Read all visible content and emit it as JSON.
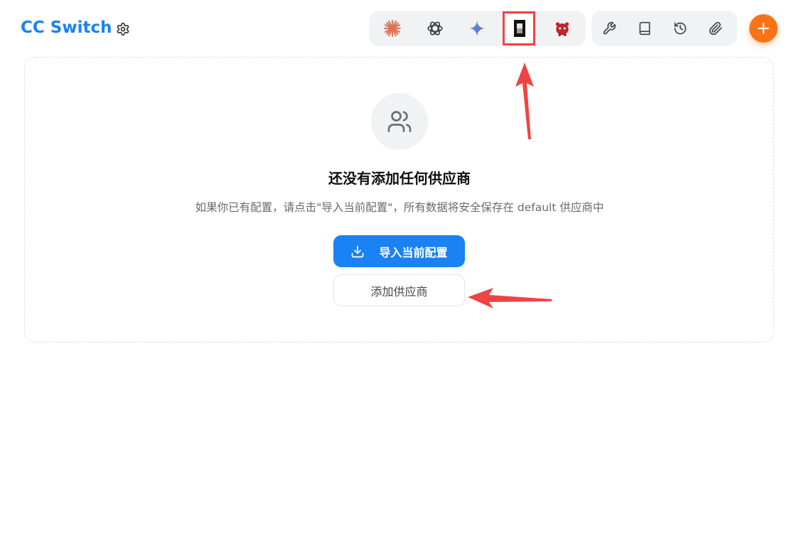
{
  "app": {
    "title": "CC Switch"
  },
  "header": {
    "settings_icon": "gear-icon",
    "app_switcher": [
      {
        "name": "claude",
        "icon": "claude-starburst-icon",
        "color": "#d97757"
      },
      {
        "name": "openai",
        "icon": "openai-icon",
        "color": "#444444"
      },
      {
        "name": "gemini",
        "icon": "gemini-sparkle-icon",
        "color": "#4285f4"
      },
      {
        "name": "opencode",
        "icon": "opencode-square-icon",
        "color": "#111111",
        "active": true
      },
      {
        "name": "mascot",
        "icon": "red-creature-icon",
        "color": "#c0262d"
      }
    ],
    "tools": [
      {
        "icon": "wrench-icon"
      },
      {
        "icon": "book-icon"
      },
      {
        "icon": "history-icon"
      },
      {
        "icon": "paperclip-icon"
      }
    ],
    "add_button_color": "#f97316"
  },
  "empty_state": {
    "icon": "users-icon",
    "title": "还没有添加任何供应商",
    "description": "如果你已有配置，请点击\"导入当前配置\"，所有数据将安全保存在 default 供应商中",
    "import_button": "导入当前配置",
    "add_button": "添加供应商"
  },
  "colors": {
    "brand": "#1a82f2",
    "accent": "#f97316",
    "annotation": "#ef4444"
  }
}
